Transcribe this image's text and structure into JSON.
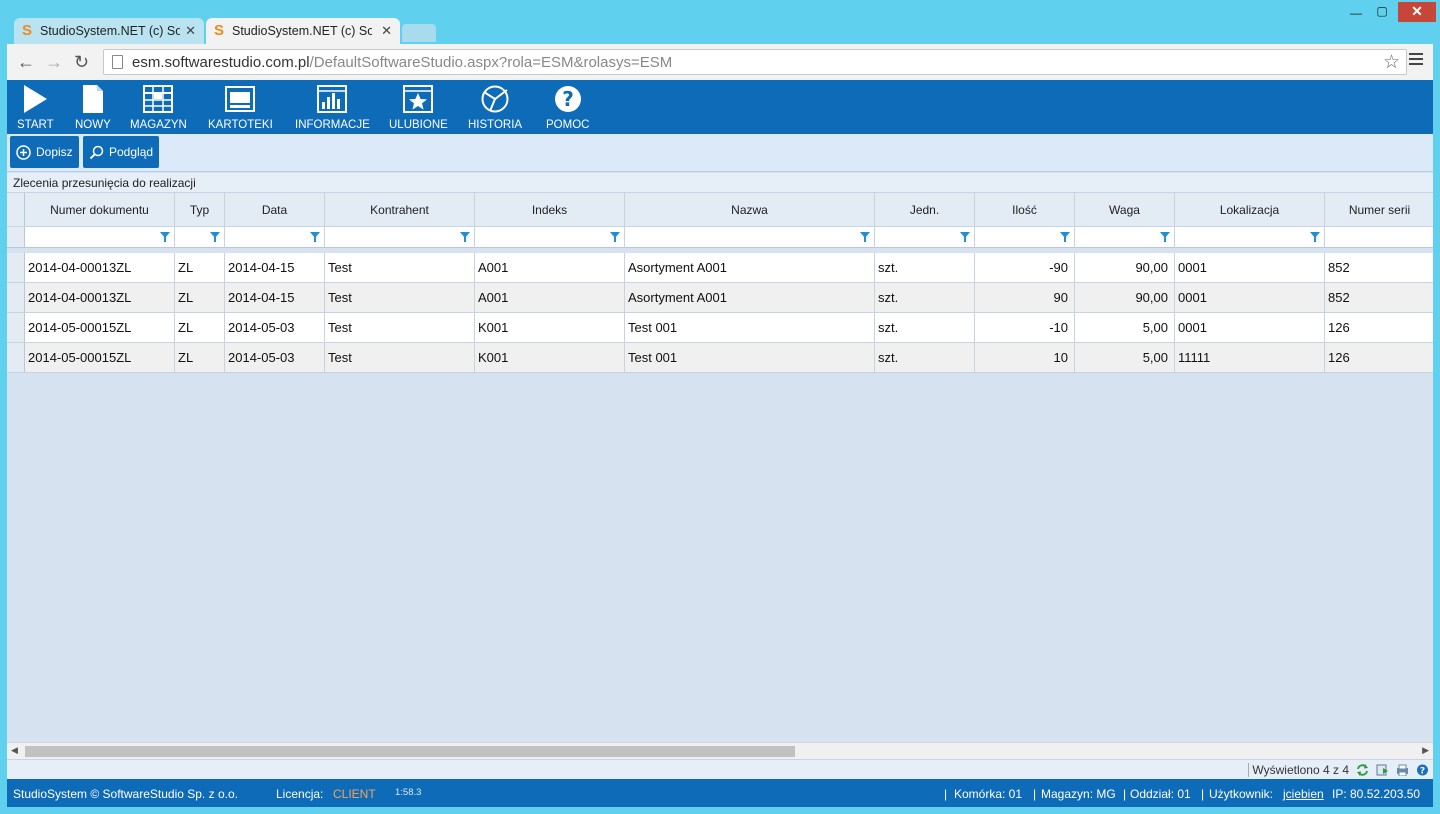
{
  "browser": {
    "tabs": [
      {
        "title": "StudioSystem.NET (c) Soft"
      },
      {
        "title": "StudioSystem.NET (c) Soft"
      }
    ],
    "url_host": "esm.softwarestudio.com.pl",
    "url_path": "/DefaultSoftwareStudio.aspx?rola=ESM&rolasys=ESM"
  },
  "toolbar": {
    "items": [
      {
        "label": "START"
      },
      {
        "label": "NOWY"
      },
      {
        "label": "MAGAZYN"
      },
      {
        "label": "KARTOTEKI"
      },
      {
        "label": "INFORMACJE"
      },
      {
        "label": "ULUBIONE"
      },
      {
        "label": "HISTORIA"
      },
      {
        "label": "POMOC"
      }
    ]
  },
  "actions": {
    "add_label": "Dopisz",
    "preview_label": "Podgląd"
  },
  "grid": {
    "title": "Zlecenia przesunięcia do realizacji",
    "columns": [
      "Numer dokumentu",
      "Typ",
      "Data",
      "Kontrahent",
      "Indeks",
      "Nazwa",
      "Jedn.",
      "Ilość",
      "Waga",
      "Lokalizacja",
      "Numer serii"
    ],
    "rows": [
      [
        "2014-04-00013ZL",
        "ZL",
        "2014-04-15",
        "Test",
        "A001",
        "Asortyment A001",
        "szt.",
        "-90",
        "90,00",
        "0001",
        "852"
      ],
      [
        "2014-04-00013ZL",
        "ZL",
        "2014-04-15",
        "Test",
        "A001",
        "Asortyment A001",
        "szt.",
        "90",
        "90,00",
        "0001",
        "852"
      ],
      [
        "2014-05-00015ZL",
        "ZL",
        "2014-05-03",
        "Test",
        "K001",
        "Test 001",
        "szt.",
        "-10",
        "5,00",
        "0001",
        "126"
      ],
      [
        "2014-05-00015ZL",
        "ZL",
        "2014-05-03",
        "Test",
        "K001",
        "Test 001",
        "szt.",
        "10",
        "5,00",
        "11111",
        "126"
      ]
    ],
    "shown": "Wyświetlono 4 z 4"
  },
  "status": {
    "copyright": "StudioSystem © SoftwareStudio Sp. z o.o.",
    "license_label": "Licencja:",
    "license_value": "CLIENT",
    "version": "1:58.3",
    "cell": "Komórka: 01",
    "warehouse": "Magazyn: MG",
    "branch": "Oddział: 01",
    "user_label": "Użytkownik:",
    "user": "jciebien",
    "ip": "IP: 80.52.203.50"
  },
  "colors": {
    "toolbar_bg": "#0e6bb7",
    "license_accent": "#f7a25a",
    "filter_icon": "#1e8fd5"
  }
}
